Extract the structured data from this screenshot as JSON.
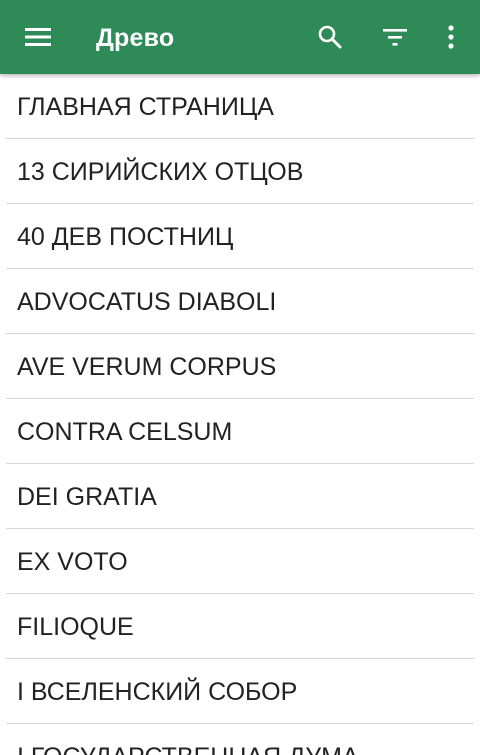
{
  "app_bar": {
    "title": "Древо",
    "background_color": "#2e8b57",
    "icons": {
      "menu": "hamburger-menu-icon",
      "search": "search-icon",
      "filter": "filter-icon",
      "more": "more-vertical-icon"
    }
  },
  "list": {
    "items": [
      {
        "label": "ГЛАВНАЯ СТРАНИЦА"
      },
      {
        "label": "13 СИРИЙСКИХ ОТЦОВ"
      },
      {
        "label": "40 ДЕВ ПОСТНИЦ"
      },
      {
        "label": "ADVOCATUS DIABOLI"
      },
      {
        "label": "AVE VERUM CORPUS"
      },
      {
        "label": "CONTRA CELSUM"
      },
      {
        "label": "DEI GRATIA"
      },
      {
        "label": "EX VOTO"
      },
      {
        "label": "FILIOQUE"
      },
      {
        "label": "I ВСЕЛЕНСКИЙ СОБОР"
      },
      {
        "label": "I ГОСУДАРСТВЕННАЯ ДУМА"
      }
    ]
  }
}
